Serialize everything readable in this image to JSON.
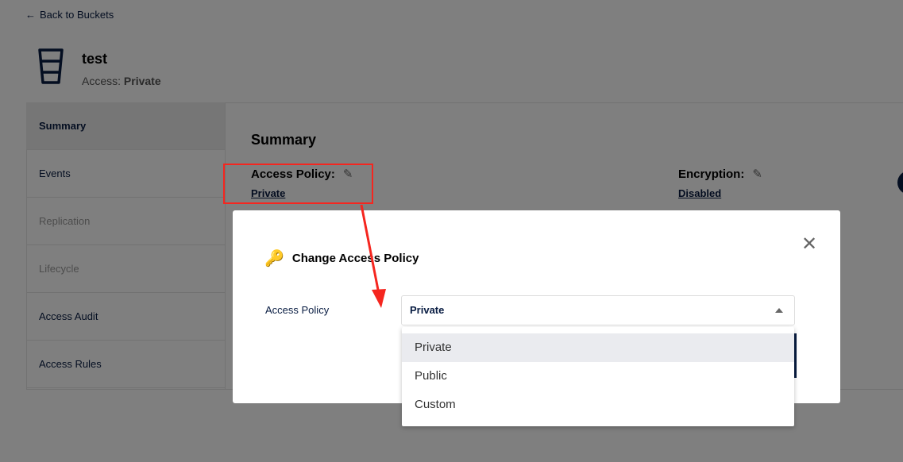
{
  "back_link": "Back to Buckets",
  "bucket": {
    "name": "test",
    "access_label": "Access:",
    "access_value": "Private"
  },
  "sidebar": {
    "items": [
      {
        "label": "Summary"
      },
      {
        "label": "Events"
      },
      {
        "label": "Replication"
      },
      {
        "label": "Lifecycle"
      },
      {
        "label": "Access Audit"
      },
      {
        "label": "Access Rules"
      }
    ]
  },
  "summary": {
    "title": "Summary",
    "access_policy_label": "Access Policy:",
    "access_policy_value": "Private",
    "encryption_label": "Encryption:",
    "encryption_value": "Disabled"
  },
  "modal": {
    "title": "Change Access Policy",
    "field_label": "Access Policy",
    "selected": "Private",
    "options": [
      "Private",
      "Public",
      "Custom"
    ]
  },
  "colors": {
    "annotation": "#f5261f",
    "primary": "#081c42"
  }
}
